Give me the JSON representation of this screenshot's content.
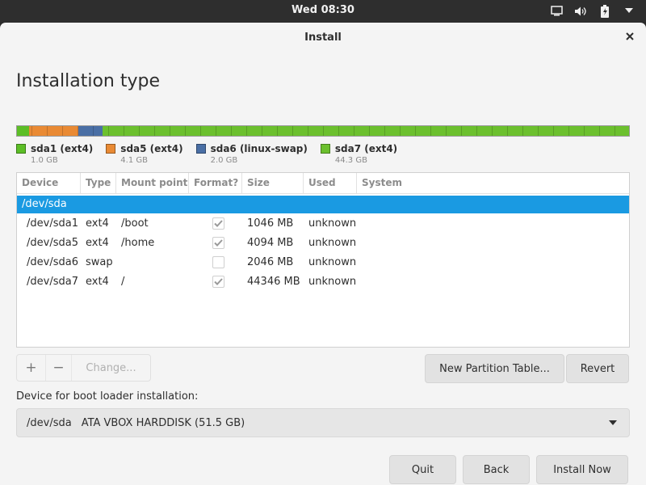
{
  "topbar": {
    "clock": "Wed 08:30"
  },
  "window": {
    "title": "Install"
  },
  "page": {
    "title": "Installation type"
  },
  "partitions": [
    {
      "name": "sda1 (ext4)",
      "size": "1.0 GB",
      "color": "#5cbe26"
    },
    {
      "name": "sda5 (ext4)",
      "size": "4.1 GB",
      "color": "#e98a34"
    },
    {
      "name": "sda6 (linux-swap)",
      "size": "2.0 GB",
      "color": "#4a6fa5"
    },
    {
      "name": "sda7 (ext4)",
      "size": "44.3 GB",
      "color": "#6cc02e"
    }
  ],
  "table": {
    "headers": [
      "Device",
      "Type",
      "Mount point",
      "Format?",
      "Size",
      "Used",
      "System"
    ],
    "selected_row": "/dev/sda",
    "rows": [
      {
        "device": "/dev/sda1",
        "type": "ext4",
        "mount": "/boot",
        "format": true,
        "size": "1046 MB",
        "used": "unknown"
      },
      {
        "device": "/dev/sda5",
        "type": "ext4",
        "mount": "/home",
        "format": true,
        "size": "4094 MB",
        "used": "unknown"
      },
      {
        "device": "/dev/sda6",
        "type": "swap",
        "mount": "",
        "format": false,
        "size": "2046 MB",
        "used": "unknown"
      },
      {
        "device": "/dev/sda7",
        "type": "ext4",
        "mount": "/",
        "format": true,
        "size": "44346 MB",
        "used": "unknown"
      }
    ]
  },
  "toolbar": {
    "add": "+",
    "remove": "−",
    "change": "Change..."
  },
  "buttons": {
    "new_partition_table": "New Partition Table...",
    "revert": "Revert",
    "quit": "Quit",
    "back": "Back",
    "install_now": "Install Now"
  },
  "bootloader": {
    "label": "Device for boot loader installation:",
    "device": "/dev/sda",
    "description": "ATA VBOX HARDDISK (51.5 GB)"
  },
  "colors": {
    "selection": "#1a9ae2",
    "window_bg": "#f4f4f4",
    "topbar_bg": "#2e2e2e"
  }
}
